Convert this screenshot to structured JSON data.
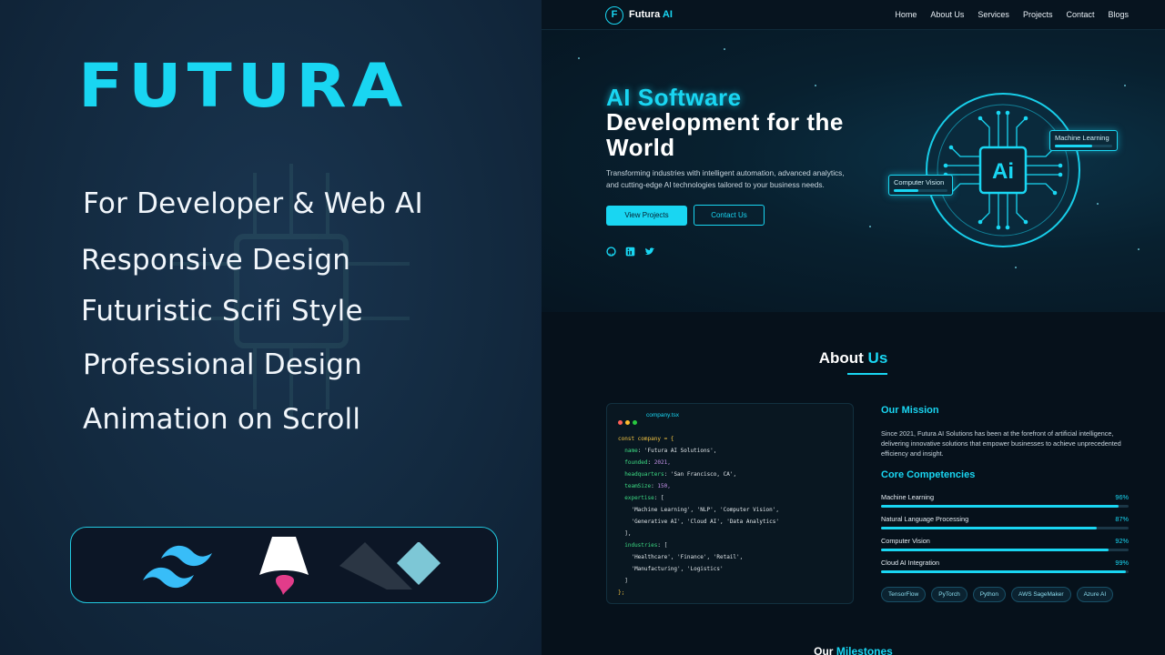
{
  "promo": {
    "brand": "FUTURA",
    "features": [
      "For Developer & Web AI",
      "Responsive Design",
      "Futuristic Scifi Style",
      "Professional Design",
      "Animation on Scroll"
    ],
    "tech_icons": [
      "tailwind-icon",
      "astro-icon",
      "shadcn-icon"
    ]
  },
  "site": {
    "logo_mark": "F",
    "logo_name": "Futura",
    "logo_suffix": "AI",
    "nav": [
      "Home",
      "About Us",
      "Services",
      "Projects",
      "Contact",
      "Blogs"
    ],
    "hero": {
      "title_accent": "AI Software",
      "title_rest": "Development for the World",
      "description": "Transforming industries with intelligent automation, advanced analytics, and cutting-edge AI technologies tailored to your business needs.",
      "primary_button": "View Projects",
      "secondary_button": "Contact Us",
      "social_icons": [
        "github-icon",
        "linkedin-icon",
        "twitter-icon"
      ],
      "chip_label": "Ai",
      "tags": [
        {
          "label": "Machine Learning",
          "level": 0.65
        },
        {
          "label": "Computer Vision",
          "level": 0.45
        }
      ]
    },
    "about": {
      "title": "About",
      "title_accent": "Us",
      "code_file": "company.tsx",
      "mission_title": "Our Mission",
      "mission_text": "Since 2021, Futura AI Solutions has been at the forefront of artificial intelligence, delivering innovative solutions that empower businesses to achieve unprecedented efficiency and insight.",
      "competencies_title": "Core Competencies",
      "skills": [
        {
          "label": "Machine Learning",
          "pct": "96%",
          "value": 96
        },
        {
          "label": "Natural Language Processing",
          "pct": "87%",
          "value": 87
        },
        {
          "label": "Computer Vision",
          "pct": "92%",
          "value": 92
        },
        {
          "label": "Cloud AI Integration",
          "pct": "99%",
          "value": 99
        }
      ],
      "tech_chips": [
        "TensorFlow",
        "PyTorch",
        "Python",
        "AWS SageMaker",
        "Azure AI"
      ]
    },
    "milestones": {
      "title": "Our",
      "title_accent": "Milestones"
    }
  },
  "code": {
    "l1": "const company = {",
    "name_key": "name",
    "name_val": "'Futura AI Solutions',",
    "founded_key": "founded",
    "founded_val": "2021,",
    "hq_key": "headquarters",
    "hq_val": "'San Francisco, CA',",
    "team_key": "teamSize",
    "team_val": "150,",
    "exp_key": "expertise",
    "exp_open": "[",
    "exp_l1": "'Machine Learning', 'NLP', 'Computer Vision',",
    "exp_l2": "'Generative AI', 'Cloud AI', 'Data Analytics'",
    "exp_close": "],",
    "ind_key": "industries",
    "ind_open": "[",
    "ind_l1": "'Healthcare', 'Finance', 'Retail',",
    "ind_l2": "'Manufacturing', 'Logistics'",
    "ind_close": "]",
    "end": "};"
  },
  "colors": {
    "accent": "#19d6f2",
    "bg_left": "#132a40",
    "bg_right": "#06111b"
  }
}
